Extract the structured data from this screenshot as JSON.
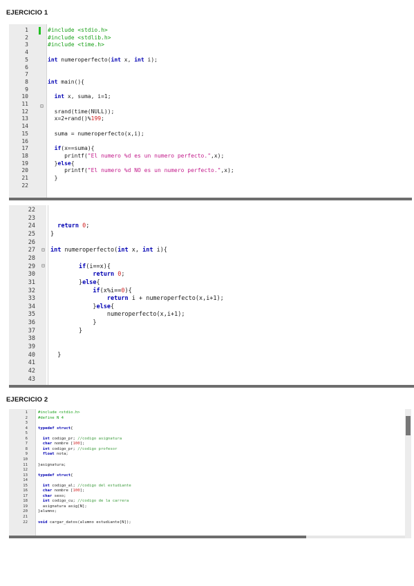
{
  "sections": [
    {
      "heading": "EJERCICIO 1"
    },
    {
      "heading": "EJERCICIO 2"
    }
  ],
  "editors": [
    {
      "lines": [
        {
          "n": "1",
          "tokens": [
            [
              "pp",
              "#include <stdio.h>"
            ]
          ]
        },
        {
          "n": "2",
          "tokens": [
            [
              "pp",
              "#include <stdlib.h>"
            ]
          ]
        },
        {
          "n": "3",
          "tokens": [
            [
              "pp",
              "#include <time.h>"
            ]
          ]
        },
        {
          "n": "4",
          "tokens": []
        },
        {
          "n": "5",
          "tokens": [
            [
              "kw",
              "int"
            ],
            [
              "",
              " numeroperfecto("
            ],
            [
              "kw",
              "int"
            ],
            [
              "",
              " x, "
            ],
            [
              "kw",
              "int"
            ],
            [
              "",
              " i);"
            ]
          ]
        },
        {
          "n": "6",
          "tokens": []
        },
        {
          "n": "7",
          "tokens": []
        },
        {
          "n": "8",
          "tokens": [
            [
              "kw",
              "int"
            ],
            [
              "",
              " main(){"
            ]
          ]
        },
        {
          "n": "9",
          "tokens": []
        },
        {
          "n": "10",
          "tokens": [
            [
              "",
              "  "
            ],
            [
              "kw",
              "int"
            ],
            [
              "",
              " x, suma, i=1;"
            ]
          ]
        },
        {
          "n": "11",
          "tokens": []
        },
        {
          "n": "12",
          "tokens": [
            [
              "",
              "  srand(time(NULL));"
            ]
          ]
        },
        {
          "n": "13",
          "tokens": [
            [
              "",
              "  x=2+rand()%"
            ],
            [
              "num",
              "199"
            ],
            [
              "",
              ";"
            ]
          ]
        },
        {
          "n": "14",
          "tokens": []
        },
        {
          "n": "15",
          "tokens": [
            [
              "",
              "  suma = numeroperfecto(x,i);"
            ]
          ]
        },
        {
          "n": "16",
          "tokens": []
        },
        {
          "n": "17",
          "tokens": [
            [
              "",
              "  "
            ],
            [
              "kw",
              "if"
            ],
            [
              "",
              "(x==suma){"
            ]
          ]
        },
        {
          "n": "18",
          "tokens": [
            [
              "",
              "     printf("
            ],
            [
              "str",
              "\"El numero %d es un numero perfecto.\""
            ],
            [
              "",
              ",x);"
            ]
          ]
        },
        {
          "n": "19",
          "tokens": [
            [
              "",
              "  }"
            ],
            [
              "kw",
              "else"
            ],
            [
              "",
              "{"
            ]
          ]
        },
        {
          "n": "20",
          "tokens": [
            [
              "",
              "     printf("
            ],
            [
              "str",
              "\"El numero %d NO es un numero perfecto.\""
            ],
            [
              "",
              ",x);"
            ]
          ]
        },
        {
          "n": "21",
          "tokens": [
            [
              "",
              "  }"
            ]
          ]
        },
        {
          "n": "22",
          "tokens": []
        }
      ]
    },
    {
      "lines": [
        {
          "n": "22",
          "tokens": []
        },
        {
          "n": "23",
          "tokens": []
        },
        {
          "n": "24",
          "tokens": [
            [
              "",
              "  "
            ],
            [
              "kw",
              "return"
            ],
            [
              "",
              " "
            ],
            [
              "num",
              "0"
            ],
            [
              "",
              ";"
            ]
          ]
        },
        {
          "n": "25",
          "tokens": [
            [
              "",
              "}"
            ]
          ]
        },
        {
          "n": "26",
          "tokens": []
        },
        {
          "n": "27",
          "tokens": [
            [
              "kw",
              "int"
            ],
            [
              "",
              " numeroperfecto("
            ],
            [
              "kw",
              "int"
            ],
            [
              "",
              " x, "
            ],
            [
              "kw",
              "int"
            ],
            [
              "",
              " i){"
            ]
          ]
        },
        {
          "n": "28",
          "tokens": []
        },
        {
          "n": "29",
          "tokens": [
            [
              "",
              "        "
            ],
            [
              "kw",
              "if"
            ],
            [
              "",
              "(i==x){"
            ]
          ]
        },
        {
          "n": "30",
          "tokens": [
            [
              "",
              "            "
            ],
            [
              "kw",
              "return"
            ],
            [
              "",
              " "
            ],
            [
              "num",
              "0"
            ],
            [
              "",
              ";"
            ]
          ]
        },
        {
          "n": "31",
          "tokens": [
            [
              "",
              "        }"
            ],
            [
              "kw",
              "else"
            ],
            [
              "",
              "{"
            ]
          ]
        },
        {
          "n": "32",
          "tokens": [
            [
              "",
              "            "
            ],
            [
              "kw",
              "if"
            ],
            [
              "",
              "(x%i=="
            ],
            [
              "num",
              "0"
            ],
            [
              "",
              "){"
            ]
          ]
        },
        {
          "n": "33",
          "tokens": [
            [
              "",
              "                "
            ],
            [
              "kw",
              "return"
            ],
            [
              "",
              " i + numeroperfecto(x,i+1);"
            ]
          ]
        },
        {
          "n": "34",
          "tokens": [
            [
              "",
              "            }"
            ],
            [
              "kw",
              "else"
            ],
            [
              "",
              "{"
            ]
          ]
        },
        {
          "n": "35",
          "tokens": [
            [
              "",
              "                numeroperfecto(x,i+1);"
            ]
          ]
        },
        {
          "n": "36",
          "tokens": [
            [
              "",
              "            }"
            ]
          ]
        },
        {
          "n": "37",
          "tokens": [
            [
              "",
              "        }"
            ]
          ]
        },
        {
          "n": "38",
          "tokens": []
        },
        {
          "n": "39",
          "tokens": []
        },
        {
          "n": "40",
          "tokens": [
            [
              "",
              "  }"
            ]
          ]
        },
        {
          "n": "41",
          "tokens": []
        },
        {
          "n": "42",
          "tokens": []
        },
        {
          "n": "43",
          "tokens": []
        }
      ]
    },
    {
      "lines": [
        {
          "n": "1",
          "tokens": [
            [
              "pp",
              "#include <stdio.h>"
            ]
          ]
        },
        {
          "n": "2",
          "tokens": [
            [
              "pp",
              "#define N 4"
            ]
          ]
        },
        {
          "n": "3",
          "tokens": []
        },
        {
          "n": "4",
          "tokens": [
            [
              "kw",
              "typedef struct"
            ],
            [
              "",
              "{"
            ]
          ]
        },
        {
          "n": "5",
          "tokens": []
        },
        {
          "n": "6",
          "tokens": [
            [
              "",
              "  "
            ],
            [
              "kw",
              "int"
            ],
            [
              "",
              " codigo_pr; "
            ],
            [
              "cm",
              "//codigo asignatura"
            ]
          ]
        },
        {
          "n": "7",
          "tokens": [
            [
              "",
              "  "
            ],
            [
              "kw",
              "char"
            ],
            [
              "",
              " nombre ["
            ],
            [
              "num",
              "100"
            ],
            [
              "",
              "];"
            ]
          ]
        },
        {
          "n": "8",
          "tokens": [
            [
              "",
              "  "
            ],
            [
              "kw",
              "int"
            ],
            [
              "",
              " codigo_pr; "
            ],
            [
              "cm",
              "//codigo profesor"
            ]
          ]
        },
        {
          "n": "9",
          "tokens": [
            [
              "",
              "  "
            ],
            [
              "kw",
              "float"
            ],
            [
              "",
              " nota;"
            ]
          ]
        },
        {
          "n": "10",
          "tokens": []
        },
        {
          "n": "11",
          "tokens": [
            [
              "",
              "}asignatura;"
            ]
          ]
        },
        {
          "n": "12",
          "tokens": []
        },
        {
          "n": "13",
          "tokens": [
            [
              "kw",
              "typedef struct"
            ],
            [
              "",
              "{"
            ]
          ]
        },
        {
          "n": "14",
          "tokens": []
        },
        {
          "n": "15",
          "tokens": [
            [
              "",
              "  "
            ],
            [
              "kw",
              "int"
            ],
            [
              "",
              " codigo_al; "
            ],
            [
              "cm",
              "//codigo del estudiante"
            ]
          ]
        },
        {
          "n": "16",
          "tokens": [
            [
              "",
              "  "
            ],
            [
              "kw",
              "char"
            ],
            [
              "",
              " nombre ["
            ],
            [
              "num",
              "100"
            ],
            [
              "",
              "];"
            ]
          ]
        },
        {
          "n": "17",
          "tokens": [
            [
              "",
              "  "
            ],
            [
              "kw",
              "char"
            ],
            [
              "",
              " sexo;"
            ]
          ]
        },
        {
          "n": "18",
          "tokens": [
            [
              "",
              "  "
            ],
            [
              "kw",
              "int"
            ],
            [
              "",
              " codigo_cu; "
            ],
            [
              "cm",
              "//codigo de la carrera"
            ]
          ]
        },
        {
          "n": "19",
          "tokens": [
            [
              "",
              "  asignatura asig[N];"
            ]
          ]
        },
        {
          "n": "20",
          "tokens": [
            [
              "",
              "}alumno;"
            ]
          ]
        },
        {
          "n": "21",
          "tokens": []
        },
        {
          "n": "22",
          "tokens": [
            [
              "kw",
              "void"
            ],
            [
              "",
              " cargar_datos(alumno estudiante[N]);"
            ]
          ]
        }
      ]
    }
  ]
}
